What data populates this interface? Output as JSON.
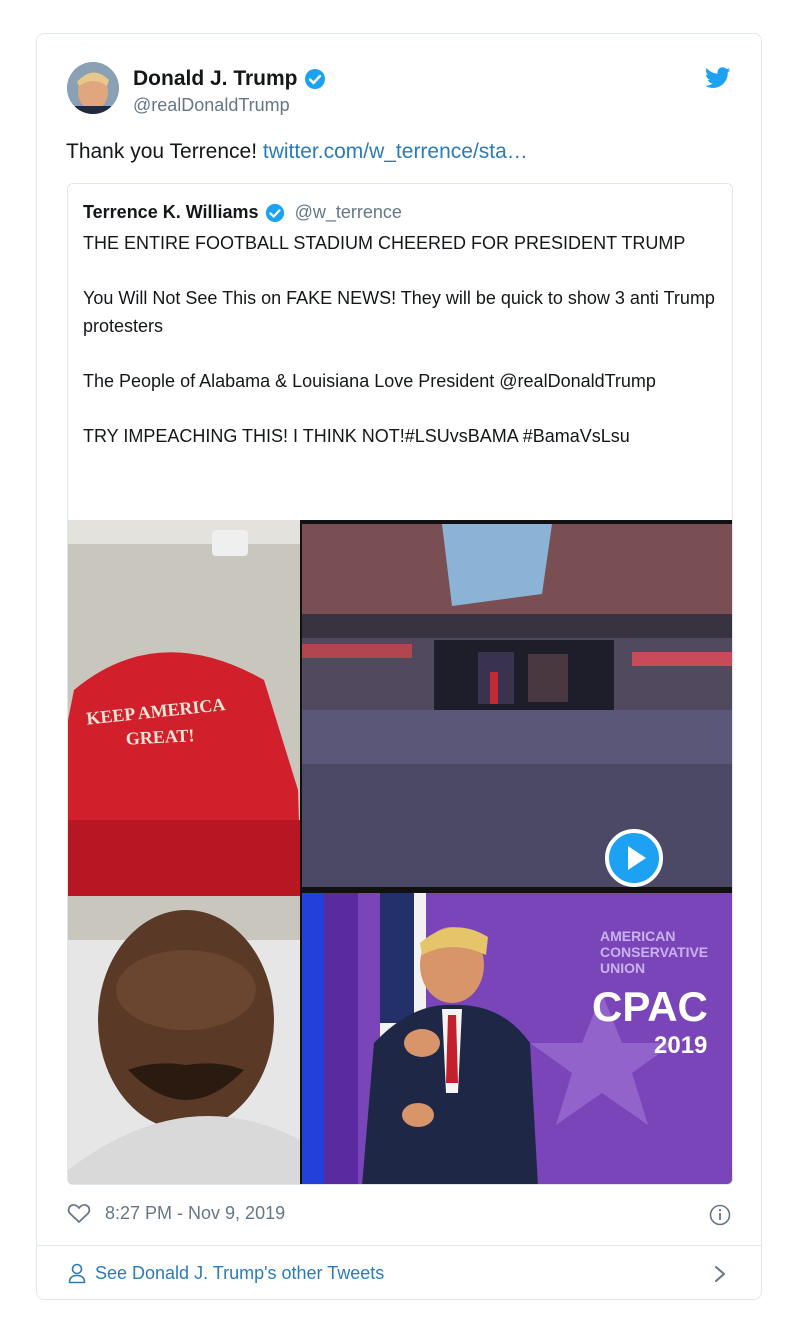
{
  "author": {
    "name": "Donald J. Trump",
    "handle": "@realDonaldTrump"
  },
  "tweet": {
    "text": "Thank you Terrence! ",
    "link": "twitter.com/w_terrence/sta…"
  },
  "quoted": {
    "name": "Terrence K. Williams",
    "handle": "@w_terrence",
    "paragraphs": [
      "THE ENTIRE FOOTBALL STADIUM CHEERED FOR PRESIDENT TRUMP",
      "You Will Not See This on FAKE NEWS! They will be quick to show 3 anti Trump protesters",
      "The People of Alabama & Louisiana Love President @realDonaldTrump",
      "TRY IMPEACHING THIS! I THINK NOT!#LSUvsBAMA #BamaVsLsu"
    ],
    "media": {
      "hat_text_line1": "KEEP AMERICA",
      "hat_text_line2": "GREAT!",
      "cpac_org_line1": "AMERICAN",
      "cpac_org_line2": "CONSERVATIVE",
      "cpac_org_line3": "UNION",
      "cpac_logo": "CPAC",
      "cpac_year": "2019"
    }
  },
  "timestamp": "8:27 PM - Nov 9, 2019",
  "footer_link": "See Donald J. Trump's other Tweets",
  "colors": {
    "twitter_blue": "#1da1f2",
    "link_blue": "#2b7bb9",
    "muted": "#657786",
    "border": "#e1e8ed"
  }
}
